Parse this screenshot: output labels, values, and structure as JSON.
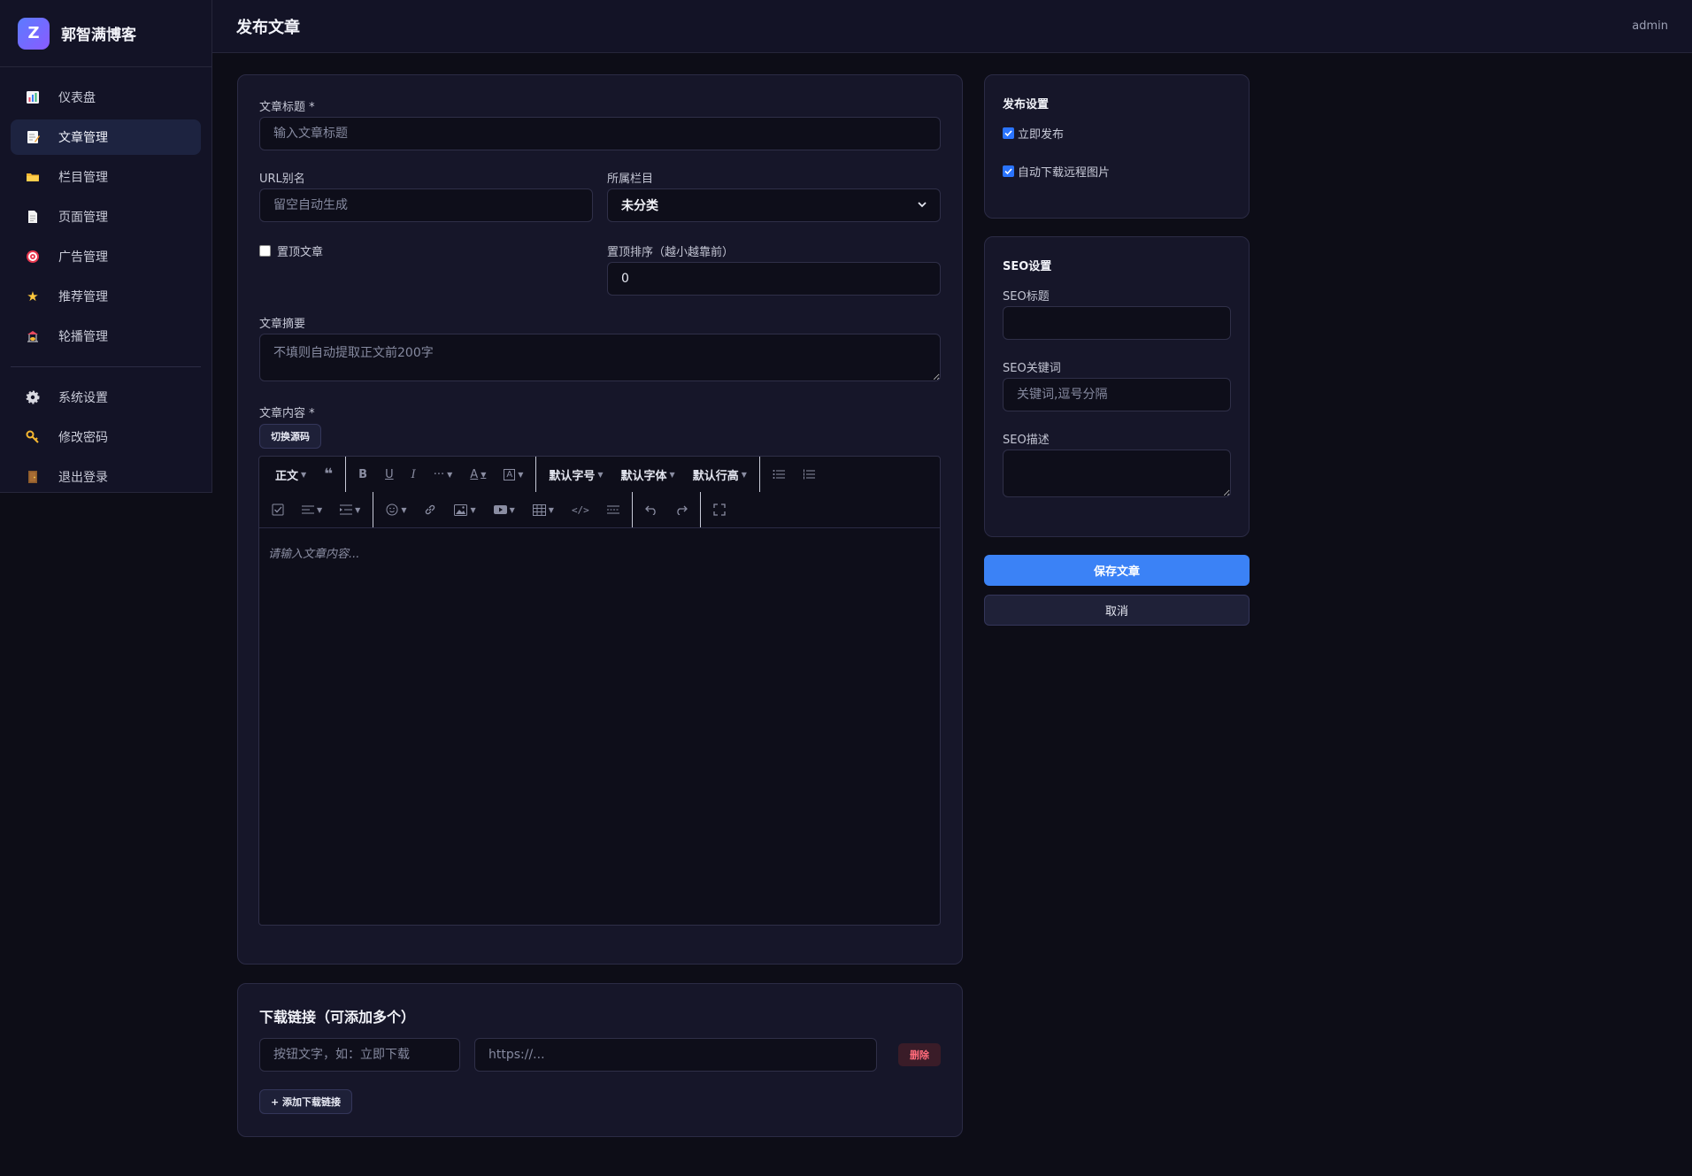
{
  "brand": {
    "logo_letter": "Z",
    "name": "郭智满博客"
  },
  "sidebar": {
    "items": [
      {
        "label": "仪表盘",
        "icon": "chart-icon"
      },
      {
        "label": "文章管理",
        "icon": "memo-icon",
        "active": true
      },
      {
        "label": "栏目管理",
        "icon": "folder-icon"
      },
      {
        "label": "页面管理",
        "icon": "page-icon"
      },
      {
        "label": "广告管理",
        "icon": "target-icon"
      },
      {
        "label": "推荐管理",
        "icon": "star-icon"
      },
      {
        "label": "轮播管理",
        "icon": "carousel-icon"
      }
    ],
    "bottom_items": [
      {
        "label": "系统设置",
        "icon": "gear-icon"
      },
      {
        "label": "修改密码",
        "icon": "key-icon"
      },
      {
        "label": "退出登录",
        "icon": "door-icon"
      }
    ]
  },
  "header": {
    "title": "发布文章",
    "user": "admin"
  },
  "form": {
    "title_label": "文章标题 *",
    "title_placeholder": "输入文章标题",
    "slug_label": "URL别名",
    "slug_placeholder": "留空自动生成",
    "category_label": "所属栏目",
    "category_value": "未分类",
    "pin_label": "置顶文章",
    "pin_checked": false,
    "pin_order_label": "置顶排序（越小越靠前）",
    "pin_order_value": "0",
    "summary_label": "文章摘要",
    "summary_placeholder": "不填则自动提取正文前200字",
    "content_label": "文章内容 *",
    "toggle_source": "切换源码",
    "editor_placeholder": "请输入文章内容..."
  },
  "toolbar": {
    "paragraph": "正文",
    "font_size": "默认字号",
    "font_family": "默认字体",
    "line_height": "默认行高"
  },
  "publish": {
    "title": "发布设置",
    "publish_now_label": "立即发布",
    "publish_now_checked": true,
    "download_images_label": "自动下载远程图片",
    "download_images_checked": true
  },
  "seo": {
    "title": "SEO设置",
    "seo_title_label": "SEO标题",
    "seo_keywords_label": "SEO关键词",
    "seo_keywords_placeholder": "关键词,逗号分隔",
    "seo_desc_label": "SEO描述"
  },
  "actions": {
    "save": "保存文章",
    "cancel": "取消"
  },
  "downloads": {
    "title": "下载链接（可添加多个）",
    "text_placeholder": "按钮文字，如：立即下载",
    "url_placeholder": "https://...",
    "delete": "删除",
    "add": "+ 添加下载链接"
  },
  "colors": {
    "accent": "#3b82f6",
    "danger": "#ff6b7a",
    "background": "#0d0d17"
  }
}
